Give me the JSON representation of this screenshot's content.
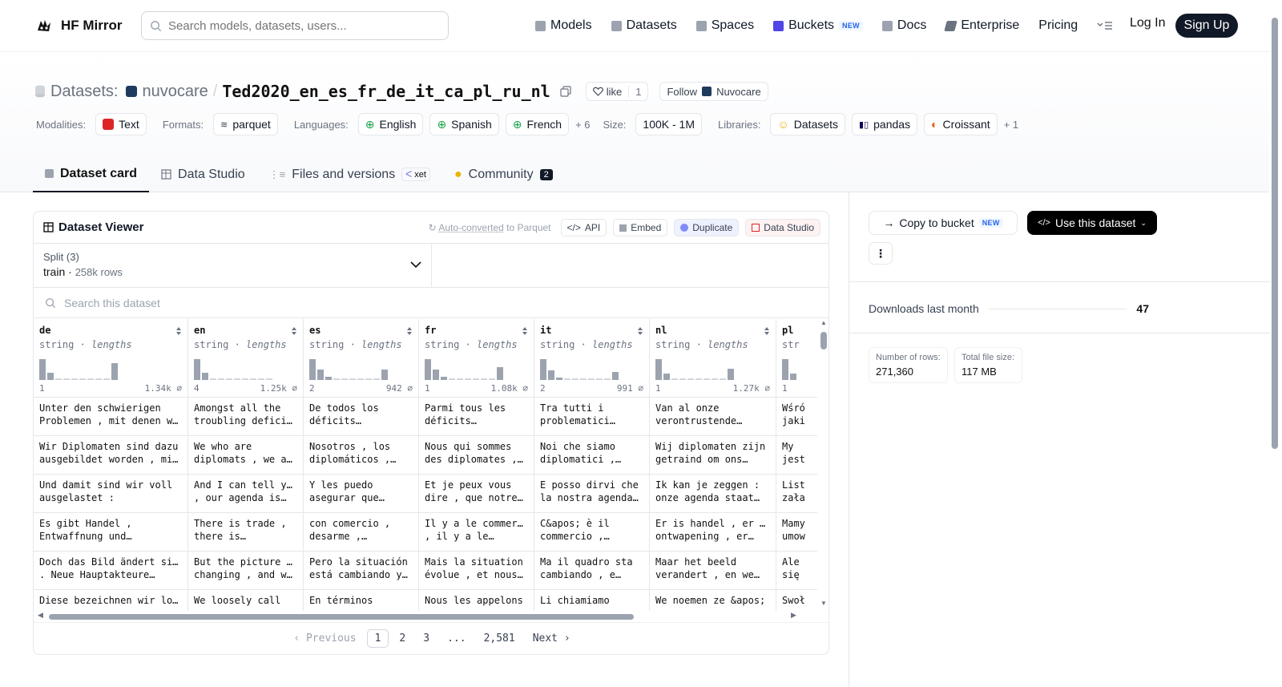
{
  "brand": {
    "name": "HF Mirror"
  },
  "search": {
    "placeholder": "Search models, datasets, users..."
  },
  "nav": {
    "items": [
      {
        "label": "Models",
        "icon": "cube-icon",
        "color": "#6b7280"
      },
      {
        "label": "Datasets",
        "icon": "database-icon",
        "color": "#6b7280"
      },
      {
        "label": "Spaces",
        "icon": "grid-icon",
        "color": "#6b7280"
      },
      {
        "label": "Buckets",
        "icon": "bucket-icon",
        "color": "#4f46e5"
      },
      {
        "label": "Docs",
        "icon": "book-icon",
        "color": "#6b7280"
      },
      {
        "label": "Enterprise",
        "icon": "enterprise-icon",
        "color": "#374151"
      }
    ],
    "buckets_badge": "NEW",
    "pricing": "Pricing",
    "login": "Log In",
    "signup": "Sign Up"
  },
  "dataset": {
    "section_label": "Datasets:",
    "owner": "nuvocare",
    "separator": "/",
    "name": "Ted2020_en_es_fr_de_it_ca_pl_ru_nl",
    "like_label": "like",
    "like_count": "1",
    "follow_label": "Follow",
    "follow_org": "Nuvocare"
  },
  "meta": {
    "modalities_label": "Modalities:",
    "modalities": [
      "Text"
    ],
    "formats_label": "Formats:",
    "formats": [
      "parquet"
    ],
    "languages_label": "Languages:",
    "languages": [
      "English",
      "Spanish",
      "French"
    ],
    "languages_more": "+ 6",
    "size_label": "Size:",
    "size": "100K - 1M",
    "libraries_label": "Libraries:",
    "libraries": [
      "Datasets",
      "pandas",
      "Croissant"
    ],
    "libraries_more": "+ 1"
  },
  "tabs": {
    "card": "Dataset card",
    "studio": "Data Studio",
    "files": "Files and versions",
    "files_badge": "xet",
    "community": "Community",
    "community_count": "2"
  },
  "viewer": {
    "title": "Dataset Viewer",
    "auto_converted": "Auto-converted",
    "to_parquet": "to Parquet",
    "api": "API",
    "embed": "Embed",
    "duplicate": "Duplicate",
    "data_studio": "Data Studio",
    "split_label": "Split (3)",
    "split_value": "train",
    "split_rows": "258k rows",
    "search_placeholder": "Search this dataset",
    "columns": [
      {
        "name": "de",
        "type": "string",
        "stat": "lengths",
        "min": "1",
        "max": "1.34k",
        "hist": [
          1,
          0.35,
          0.05,
          0.05,
          0.05,
          0.05,
          0.05,
          0.05,
          0.05,
          0.8
        ]
      },
      {
        "name": "en",
        "type": "string",
        "stat": "lengths",
        "min": "4",
        "max": "1.25k",
        "hist": [
          1,
          0.35,
          0.05,
          0.05,
          0.05,
          0.05,
          0.05,
          0.05,
          0.05,
          0.05
        ]
      },
      {
        "name": "es",
        "type": "string",
        "stat": "lengths",
        "min": "2",
        "max": "942",
        "hist": [
          1,
          0.5,
          0.15,
          0.05,
          0.05,
          0.05,
          0.05,
          0.05,
          0.05,
          0.5
        ]
      },
      {
        "name": "fr",
        "type": "string",
        "stat": "lengths",
        "min": "1",
        "max": "1.08k",
        "hist": [
          1,
          0.5,
          0.15,
          0.05,
          0.05,
          0.05,
          0.05,
          0.05,
          0.05,
          0.6
        ]
      },
      {
        "name": "it",
        "type": "string",
        "stat": "lengths",
        "min": "2",
        "max": "991",
        "hist": [
          1,
          0.45,
          0.12,
          0.05,
          0.05,
          0.05,
          0.05,
          0.05,
          0.05,
          0.4
        ]
      },
      {
        "name": "nl",
        "type": "string",
        "stat": "lengths",
        "min": "1",
        "max": "1.27k",
        "hist": [
          1,
          0.3,
          0.05,
          0.05,
          0.05,
          0.05,
          0.05,
          0.05,
          0.05,
          0.55
        ]
      },
      {
        "name": "pl",
        "type": "str",
        "stat": "",
        "min": "1",
        "max": "",
        "hist": [
          1,
          0.3
        ]
      }
    ],
    "rows": [
      [
        [
          "Unter den schwierigen",
          "Problemen , mit denen w…"
        ],
        [
          "Amongst all the",
          "troubling deficit…"
        ],
        [
          "De todos los",
          "déficits…"
        ],
        [
          "Parmi tous les",
          "déficits…"
        ],
        [
          "Tra tutti i",
          "problematici…"
        ],
        [
          "Van al onze",
          "verontrustende…"
        ],
        [
          "Wśró",
          "jaki"
        ]
      ],
      [
        [
          "Wir Diplomaten sind dazu",
          "ausgebildet worden , mi…"
        ],
        [
          "We who are",
          "diplomats , we ar…"
        ],
        [
          "Nosotros , los",
          "diplomáticos ,…"
        ],
        [
          "Nous qui sommes",
          "des diplomates ,…"
        ],
        [
          "Noi che siamo",
          "diplomatici ,…"
        ],
        [
          "Wij diplomaten zijn",
          "getraind om ons…"
        ],
        [
          "My",
          "jest"
        ]
      ],
      [
        [
          "Und damit sind wir voll",
          "ausgelastet :"
        ],
        [
          "And I can tell you",
          ", our agenda is…"
        ],
        [
          "Y les puedo",
          "asegurar que…"
        ],
        [
          "Et je peux vous",
          "dire , que notre…"
        ],
        [
          "E posso dirvi che",
          "la nostra agenda …"
        ],
        [
          "Ik kan je zeggen :",
          "onze agenda staat…"
        ],
        [
          "List",
          "zała"
        ]
      ],
      [
        [
          "Es gibt Handel ,",
          "Entwaffnung und…"
        ],
        [
          "There is trade ,",
          "there is…"
        ],
        [
          "con comercio ,",
          "desarme ,…"
        ],
        [
          "Il y a le commerce",
          ", il y a le…"
        ],
        [
          "C&apos; è il",
          "commercio ,…"
        ],
        [
          "Er is handel , er is",
          "ontwapening , er…"
        ],
        [
          "Mamy",
          "umow"
        ]
      ],
      [
        [
          "Doch das Bild ändert sich",
          ". Neue Hauptakteure…"
        ],
        [
          "But the picture is",
          "changing , and we…"
        ],
        [
          "Pero la situación",
          "está cambiando y…"
        ],
        [
          "Mais la situation",
          "évolue , et nous…"
        ],
        [
          "Ma il quadro sta",
          "cambiando , e…"
        ],
        [
          "Maar het beeld",
          "verandert , en we…"
        ],
        [
          "Ale",
          "się"
        ]
      ],
      [
        [
          "Diese bezeichnen wir lose",
          ""
        ],
        [
          "We loosely call",
          ""
        ],
        [
          "En términos",
          ""
        ],
        [
          "Nous les appelons",
          ""
        ],
        [
          "Li chiamiamo",
          ""
        ],
        [
          "We noemen ze &apos;",
          ""
        ],
        [
          "Swoł",
          ""
        ]
      ]
    ],
    "pager": {
      "prev": "Previous",
      "pages": [
        "1",
        "2",
        "3",
        "...",
        "2,581"
      ],
      "next": "Next"
    }
  },
  "sidebar": {
    "copy_bucket": "Copy to bucket",
    "copy_badge": "NEW",
    "use_dataset": "Use this dataset",
    "downloads_label": "Downloads last month",
    "downloads_value": "47",
    "rows_label": "Number of rows:",
    "rows_value": "271,360",
    "size_label": "Total file size:",
    "size_value": "117 MB"
  }
}
